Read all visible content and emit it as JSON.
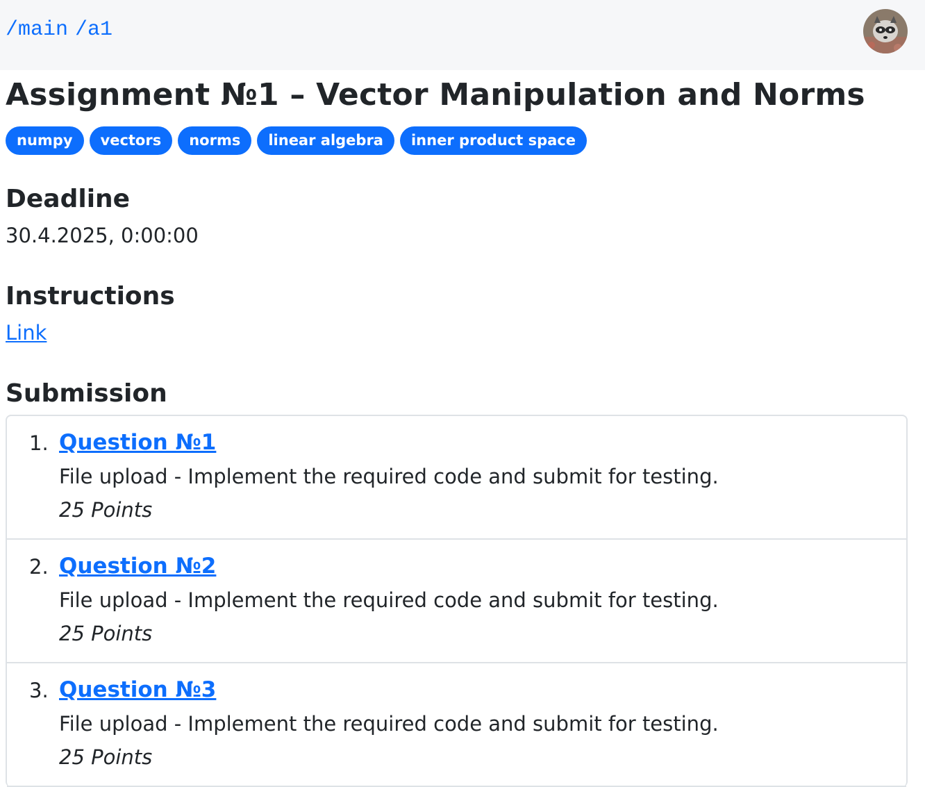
{
  "breadcrumb": [
    "/main",
    "/a1"
  ],
  "user": {
    "avatar_icon": "raccoon-avatar-icon"
  },
  "assignment": {
    "title": "Assignment №1 – Vector Manipulation and Norms",
    "tags": [
      "numpy",
      "vectors",
      "norms",
      "linear algebra",
      "inner product space"
    ]
  },
  "deadline": {
    "heading": "Deadline",
    "value": "30.4.2025, 0:00:00"
  },
  "instructions": {
    "heading": "Instructions",
    "link_label": "Link"
  },
  "submission": {
    "heading": "Submission",
    "questions": [
      {
        "number": "1.",
        "title": "Question №1",
        "description": "File upload - Implement the required code and submit for testing.",
        "points": "25 Points"
      },
      {
        "number": "2.",
        "title": "Question №2",
        "description": "File upload - Implement the required code and submit for testing.",
        "points": "25 Points"
      },
      {
        "number": "3.",
        "title": "Question №3",
        "description": "File upload - Implement the required code and submit for testing.",
        "points": "25 Points"
      }
    ]
  },
  "colors": {
    "accent": "#0d6efd",
    "topbar_bg": "#f6f7f9",
    "border": "#dee2e6",
    "text": "#212529"
  }
}
